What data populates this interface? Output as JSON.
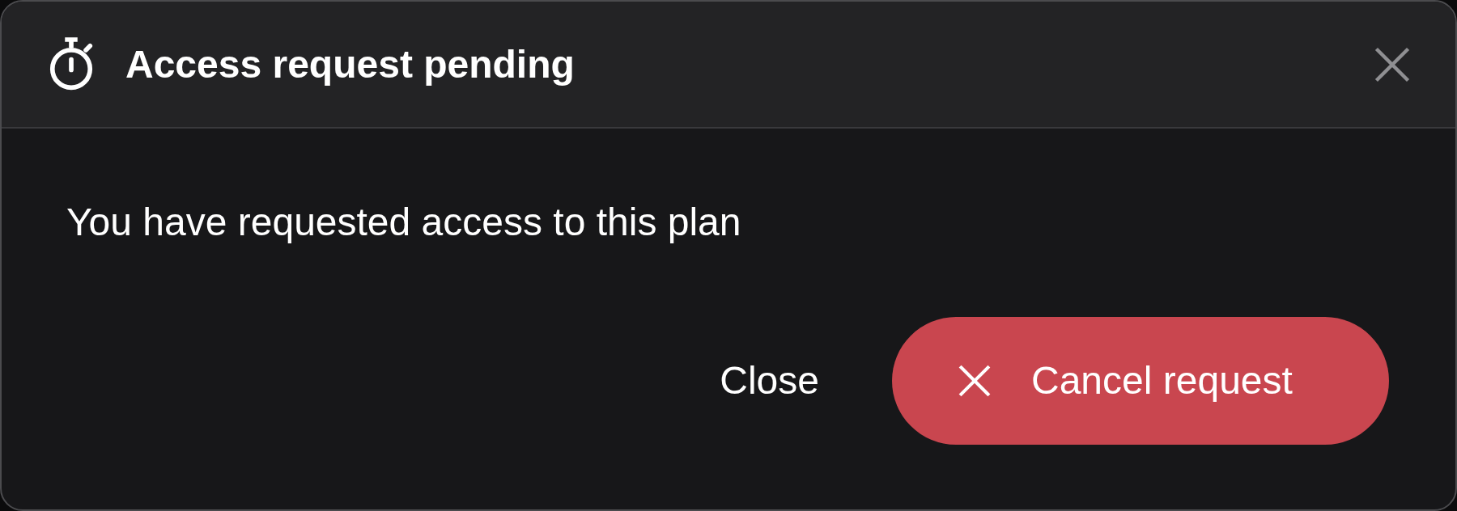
{
  "dialog": {
    "title": "Access request pending",
    "message": "You have requested access to this plan",
    "buttons": [
      {
        "label": "Close",
        "kind": "text"
      },
      {
        "label": "Cancel request",
        "kind": "danger"
      }
    ]
  }
}
